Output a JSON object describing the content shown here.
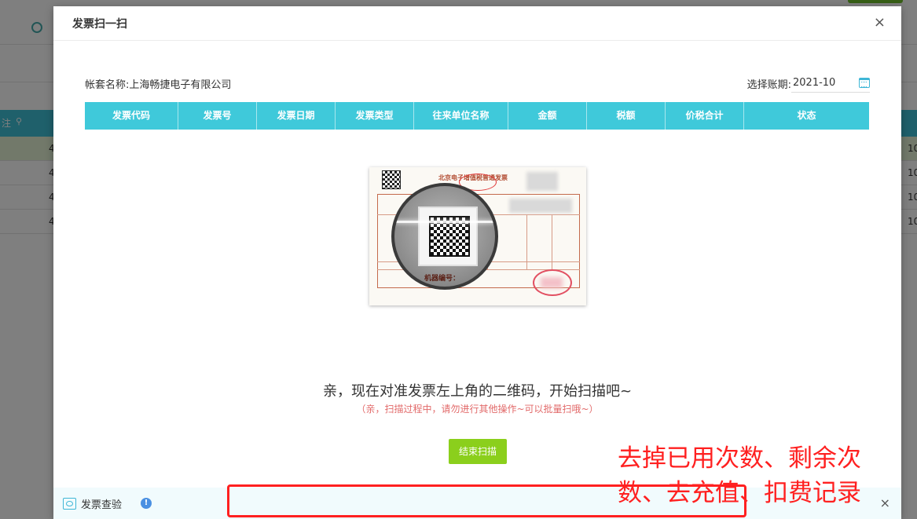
{
  "background": {
    "row_values": [
      "4",
      "4",
      "4",
      "4"
    ],
    "right_values": [
      "10",
      "10",
      "10",
      "10"
    ],
    "head_left_label": "注"
  },
  "modal": {
    "title": "发票扫一扫",
    "close_symbol": "×",
    "account_set_label": "帐套名称:上海畅捷电子有限公司",
    "period_label": "选择账期:",
    "period_value": "2021-10",
    "columns": [
      "发票代码",
      "发票号",
      "发票日期",
      "发票类型",
      "往来单位名称",
      "金额",
      "税额",
      "价税合计",
      "状态"
    ],
    "invoice_image": {
      "title": "北京电子增值税普通发票",
      "machine_no_label": "机器编号："
    },
    "scan_prompt": "亲，现在对准发票左上角的二维码，开始扫描吧~",
    "scan_hint": "（亲，扫描过程中，请勿进行其他操作~可以批量扫哦~）",
    "end_scan_button": "结束扫描",
    "bottom_bar": {
      "verify_label": "发票查验",
      "info_symbol": "!",
      "close_symbol": "×"
    }
  },
  "annotation": {
    "note": "去掉已用次数、剩余次数、去充值、扣费记录",
    "color": "#ff2020"
  },
  "colors": {
    "table_header": "#3fc9da",
    "end_button": "#8bcf1c",
    "hint_text": "#e26a6a"
  }
}
